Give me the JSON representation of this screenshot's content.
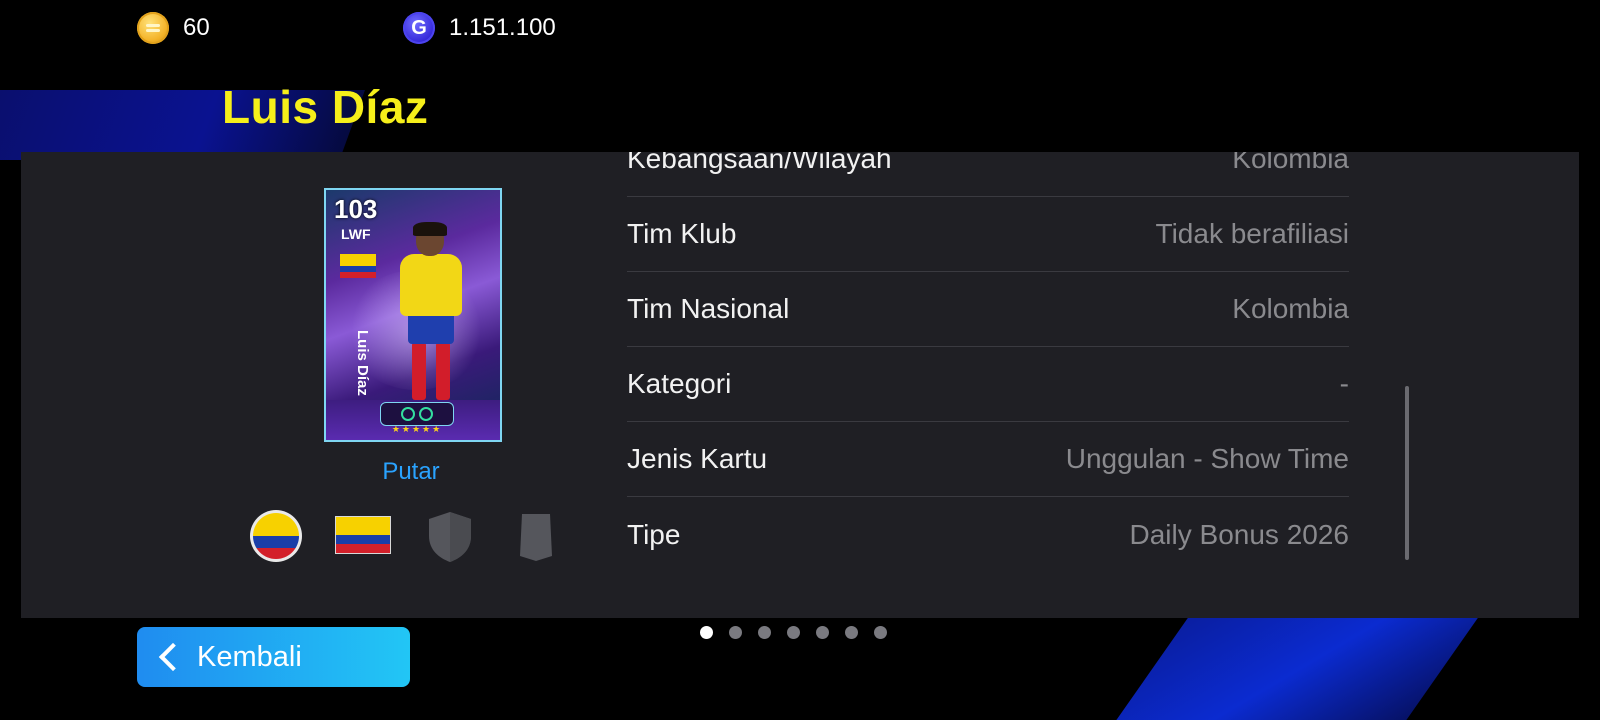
{
  "currency": {
    "coins": {
      "icon": "coin-icon",
      "value": "60"
    },
    "gp": {
      "icon": "gp-icon",
      "glyph": "G",
      "value": "1.151.100"
    }
  },
  "player": {
    "name": "Luis Díaz"
  },
  "card": {
    "rating": "103",
    "position": "LWF",
    "name": "Luis Díaz",
    "stars": "★★★★★",
    "flag": "colombia-flag-icon"
  },
  "actions": {
    "rotate_label": "Putar",
    "back_label": "Kembali"
  },
  "badges": [
    "federation-icon",
    "colombia-flag-icon",
    "club-shield-icon",
    "kit-icon"
  ],
  "info": [
    {
      "label": "Kebangsaan/Wilayah",
      "value": "Kolombia"
    },
    {
      "label": "Tim Klub",
      "value": "Tidak berafiliasi"
    },
    {
      "label": "Tim Nasional",
      "value": "Kolombia"
    },
    {
      "label": "Kategori",
      "value": "-"
    },
    {
      "label": "Jenis Kartu",
      "value": "Unggulan - Show Time"
    },
    {
      "label": "Tipe",
      "value": "Daily Bonus 2026"
    }
  ],
  "pagination": {
    "total": 7,
    "active": 1
  },
  "colors": {
    "title": "#f6ef1a",
    "accent": "#2aa3ff",
    "panel": "#1f1f24"
  }
}
